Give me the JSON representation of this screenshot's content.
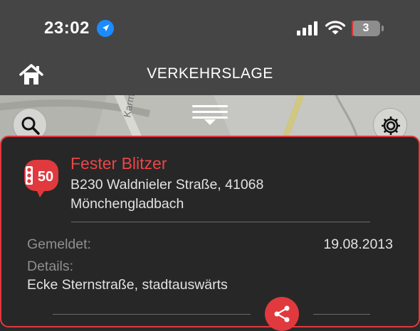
{
  "status_bar": {
    "time": "23:02",
    "battery_level": "3",
    "location_icon": "location-arrow-icon",
    "signal_icon": "cellular-signal-icon",
    "wifi_icon": "wifi-icon",
    "battery_fill_fraction": 0.03
  },
  "nav": {
    "title": "VERKEHRSLAGE",
    "home_icon": "home-icon"
  },
  "map": {
    "street_label": "Karman",
    "search_icon": "search-icon",
    "settings_icon": "gear-icon",
    "drawer_icon": "drawer-handle-icon"
  },
  "incident": {
    "icon": "speed-camera-50-icon",
    "icon_label": "50",
    "title": "Fester Blitzer",
    "address_line1": "B230 Waldnieler Straße, 41068",
    "address_line2": "Mönchengladbach",
    "reported_label": "Gemeldet:",
    "reported_date": "19.08.2013",
    "details_label": "Details:",
    "details_text": "Ecke Sternstraße, stadtauswärts",
    "share_icon": "share-icon"
  },
  "colors": {
    "accent": "#e0393e",
    "title_red": "#ec4646",
    "bar_bg": "#454545",
    "card_bg": "#272727",
    "location_blue": "#1a8cff"
  }
}
